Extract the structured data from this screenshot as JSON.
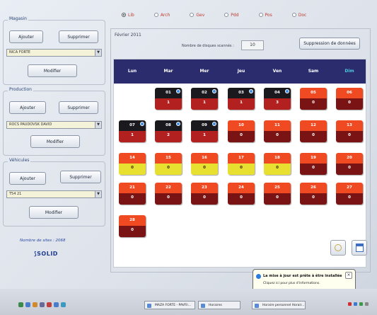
{
  "topbar": {
    "options": [
      {
        "label": "Lib",
        "selected": true
      },
      {
        "label": "Arch",
        "selected": false
      },
      {
        "label": "Gev",
        "selected": false
      },
      {
        "label": "Pdd",
        "selected": false
      },
      {
        "label": "Pos",
        "selected": false
      },
      {
        "label": "Doc",
        "selected": false
      }
    ]
  },
  "left": {
    "groups": [
      {
        "title": "Magasin",
        "add": "Ajouter",
        "remove": "Supprimer",
        "select": "NICA FORTE",
        "modify": "Modifier"
      },
      {
        "title": "Production",
        "add": "Ajouter",
        "remove": "Supprimer",
        "select": "ROCS PAUDOVSK DAVID",
        "modify": "Modifier"
      },
      {
        "title": "Véhicules",
        "add": "Ajouter",
        "remove": "Supprimer",
        "select": "T54 21",
        "modify": "Modifier"
      }
    ],
    "number_line": "Nombre de sites : 2068",
    "logo": "SOLID"
  },
  "main": {
    "month": "Février 2011",
    "count_label": "Nombre de disques scannés :",
    "count_value": "10",
    "delete_button": "Suppression de données",
    "day_names": [
      "Lun",
      "Mar",
      "Mer",
      "Jeu",
      "Ven",
      "Sam",
      "Dim"
    ]
  },
  "calendar": [
    {
      "day": "01",
      "value": "1",
      "style": "dark",
      "info": true,
      "col": 1,
      "row": 0
    },
    {
      "day": "02",
      "value": "1",
      "style": "dark",
      "info": true,
      "col": 2,
      "row": 0
    },
    {
      "day": "03",
      "value": "1",
      "style": "dark",
      "info": true,
      "col": 3,
      "row": 0
    },
    {
      "day": "04",
      "value": "3",
      "style": "dark",
      "info": true,
      "col": 4,
      "row": 0
    },
    {
      "day": "05",
      "value": "0",
      "style": "red",
      "info": false,
      "col": 5,
      "row": 0
    },
    {
      "day": "06",
      "value": "0",
      "style": "red",
      "info": false,
      "col": 6,
      "row": 0
    },
    {
      "day": "07",
      "value": "1",
      "style": "dark",
      "info": true,
      "col": 0,
      "row": 1
    },
    {
      "day": "08",
      "value": "2",
      "style": "dark",
      "info": true,
      "col": 1,
      "row": 1
    },
    {
      "day": "09",
      "value": "1",
      "style": "dark",
      "info": true,
      "col": 2,
      "row": 1
    },
    {
      "day": "10",
      "value": "0",
      "style": "red",
      "info": false,
      "col": 3,
      "row": 1
    },
    {
      "day": "11",
      "value": "0",
      "style": "red",
      "info": false,
      "col": 4,
      "row": 1
    },
    {
      "day": "12",
      "value": "0",
      "style": "red",
      "info": false,
      "col": 5,
      "row": 1
    },
    {
      "day": "13",
      "value": "0",
      "style": "red",
      "info": false,
      "col": 6,
      "row": 1
    },
    {
      "day": "14",
      "value": "0",
      "style": "yellow",
      "info": false,
      "col": 0,
      "row": 2
    },
    {
      "day": "15",
      "value": "0",
      "style": "yellow",
      "info": false,
      "col": 1,
      "row": 2
    },
    {
      "day": "16",
      "value": "0",
      "style": "yellow",
      "info": false,
      "col": 2,
      "row": 2
    },
    {
      "day": "17",
      "value": "0",
      "style": "yellow",
      "info": false,
      "col": 3,
      "row": 2
    },
    {
      "day": "18",
      "value": "0",
      "style": "yellow",
      "info": false,
      "col": 4,
      "row": 2
    },
    {
      "day": "19",
      "value": "0",
      "style": "red",
      "info": false,
      "col": 5,
      "row": 2
    },
    {
      "day": "20",
      "value": "0",
      "style": "red",
      "info": false,
      "col": 6,
      "row": 2
    },
    {
      "day": "21",
      "value": "0",
      "style": "red",
      "info": false,
      "col": 0,
      "row": 3
    },
    {
      "day": "22",
      "value": "0",
      "style": "red",
      "info": false,
      "col": 1,
      "row": 3
    },
    {
      "day": "23",
      "value": "0",
      "style": "red",
      "info": false,
      "col": 2,
      "row": 3
    },
    {
      "day": "24",
      "value": "0",
      "style": "red",
      "info": false,
      "col": 3,
      "row": 3
    },
    {
      "day": "25",
      "value": "0",
      "style": "red",
      "info": false,
      "col": 4,
      "row": 3
    },
    {
      "day": "26",
      "value": "0",
      "style": "red",
      "info": false,
      "col": 5,
      "row": 3
    },
    {
      "day": "27",
      "value": "0",
      "style": "red",
      "info": false,
      "col": 6,
      "row": 3
    },
    {
      "day": "28",
      "value": "0",
      "style": "red",
      "info": false,
      "col": 0,
      "row": 4
    }
  ],
  "taskbar": {
    "items": [
      "MAZA FORTE - PAVFil...",
      "Horaires",
      "Horaire personnel Horair..."
    ]
  },
  "notification": {
    "title": "La mise à jour est prête à être installée",
    "subtitle": "Cliquez ici pour plus d'informations."
  },
  "colors": {
    "header": "#2a2c6e",
    "dark": "#1a1a1e",
    "red": "#f04a22",
    "yellow": "#e8e030"
  }
}
